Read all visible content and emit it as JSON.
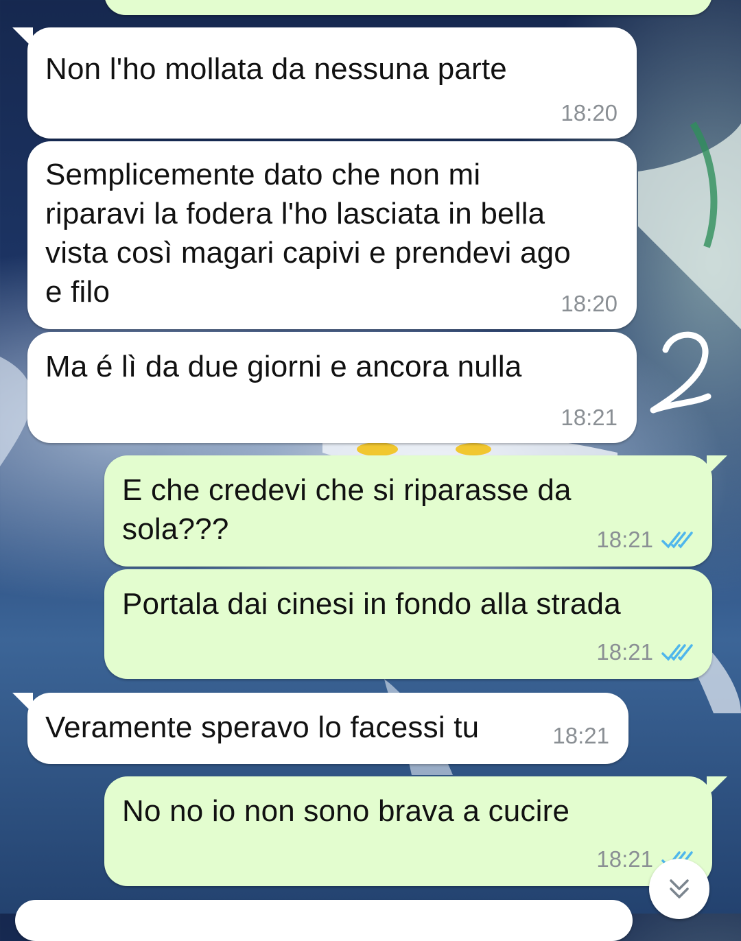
{
  "chat": {
    "messages": [
      {
        "id": "m0",
        "direction": "outgoing",
        "text": "",
        "time": ""
      },
      {
        "id": "m1",
        "direction": "incoming",
        "text": "Non l'ho mollata da nessuna parte",
        "time": "18:20"
      },
      {
        "id": "m2",
        "direction": "incoming",
        "text": "Semplicemente dato che non mi\nriparavi la fodera l'ho lasciata in bella\nvista così magari capivi e prendevi ago\ne filo",
        "time": "18:20"
      },
      {
        "id": "m3",
        "direction": "incoming",
        "text": "Ma é lì da due giorni e ancora nulla",
        "time": "18:21"
      },
      {
        "id": "m4",
        "direction": "outgoing",
        "text": "E che credevi che si riparasse da\nsola???",
        "time": "18:21",
        "status_icon": "double-check-read-icon"
      },
      {
        "id": "m5",
        "direction": "outgoing",
        "text": "Portala dai cinesi in fondo alla strada",
        "time": "18:21",
        "status_icon": "double-check-read-icon"
      },
      {
        "id": "m6",
        "direction": "incoming",
        "text": "Veramente speravo lo facessi tu",
        "time": "18:21"
      },
      {
        "id": "m7",
        "direction": "outgoing",
        "text": "No no io non sono brava a cucire",
        "time": "18:21",
        "status_icon": "double-check-read-icon"
      }
    ]
  },
  "annotation": {
    "handwritten_text": "2"
  },
  "controls": {
    "scroll_down_icon": "chevron-double-down-icon"
  },
  "colors": {
    "incoming_bubble": "#ffffff",
    "outgoing_bubble": "#e3fdcf",
    "read_check": "#4fb6ec",
    "timestamp": "#8a8f94"
  }
}
